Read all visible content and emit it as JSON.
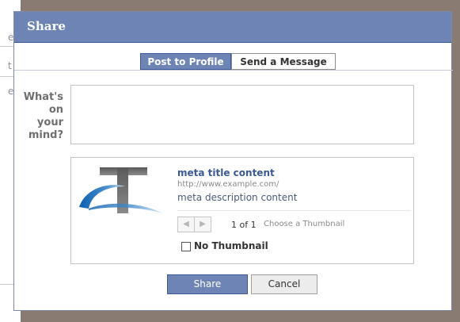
{
  "background": {
    "fragments": [
      "e",
      "t",
      "e"
    ]
  },
  "dialog": {
    "title": "Share",
    "tabs": [
      {
        "label": "Post to Profile",
        "active": true
      },
      {
        "label": "Send a Message",
        "active": false
      }
    ],
    "prompt_lines": [
      "What's",
      "on",
      "your",
      "mind?"
    ],
    "attachment": {
      "title": "meta title content",
      "url": "http://www.example.com/",
      "description": "meta description content",
      "nav_prev_icon": "◀",
      "nav_next_icon": "▶",
      "page_count": "1 of 1",
      "choose_thumbnail": "Choose a Thumbnail",
      "no_thumbnail_label": "No Thumbnail",
      "no_thumbnail_checked": false
    },
    "buttons": {
      "share": "Share",
      "cancel": "Cancel"
    }
  },
  "colors": {
    "accent": "#6d84b4",
    "accent_border": "#3b5998",
    "link": "#3b5998"
  }
}
